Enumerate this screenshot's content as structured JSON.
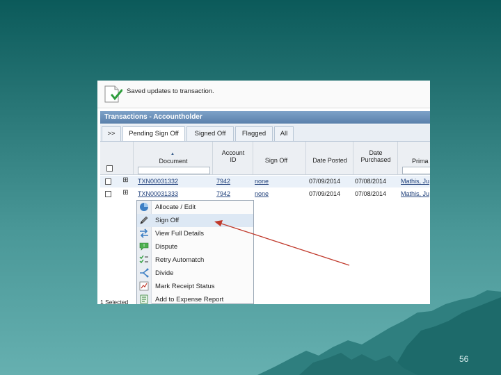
{
  "colors": {
    "accent": "#5a80ab",
    "link": "#1f3f7a",
    "arrow": "#c0392b",
    "check": "#2e9d3c"
  },
  "notice": {
    "text": "Saved updates to transaction.",
    "icon": "document-check-icon"
  },
  "panel": {
    "title": "Transactions - Accountholder"
  },
  "tabs": {
    "nav": ">>",
    "items": [
      {
        "label": "Pending Sign Off",
        "active": true
      },
      {
        "label": "Signed Off",
        "active": false
      },
      {
        "label": "Flagged",
        "active": false
      },
      {
        "label": "All",
        "active": false
      }
    ]
  },
  "columns": {
    "document": "Document",
    "account_id_1": "Account",
    "account_id_2": "ID",
    "sign_off": "Sign Off",
    "date_posted": "Date Posted",
    "date_purchased_1": "Date",
    "date_purchased_2": "Purchased",
    "primary": "Prima"
  },
  "rows": [
    {
      "document": "TXN00031332",
      "account_id": "7942",
      "sign_off": "none",
      "date_posted": "07/09/2014",
      "date_purchased": "07/08/2014",
      "primary": "Mathis, Ju"
    },
    {
      "document": "TXN00031333",
      "account_id": "7942",
      "sign_off": "none",
      "date_posted": "07/09/2014",
      "date_purchased": "07/08/2014",
      "primary": "Mathis, Ju"
    }
  ],
  "context_menu": {
    "items": [
      {
        "label": "Allocate / Edit",
        "icon": "pie-chart-icon"
      },
      {
        "label": "Sign Off",
        "icon": "pen-icon"
      },
      {
        "label": "View Full Details",
        "icon": "swap-arrows-icon"
      },
      {
        "label": "Dispute",
        "icon": "speech-bubble-icon"
      },
      {
        "label": "Retry Automatch",
        "icon": "checklist-icon"
      },
      {
        "label": "Divide",
        "icon": "split-icon"
      },
      {
        "label": "Mark Receipt Status",
        "icon": "chart-doc-icon"
      },
      {
        "label": "Add to Expense Report",
        "icon": "report-add-icon"
      }
    ]
  },
  "status": {
    "text": "1 Selected"
  },
  "slide": {
    "number": "56"
  }
}
